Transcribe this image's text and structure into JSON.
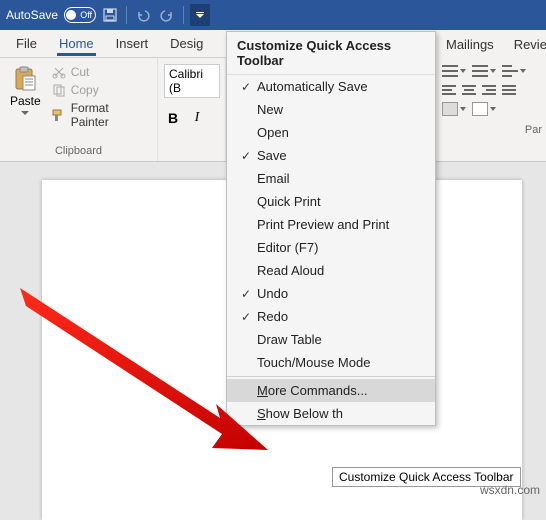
{
  "titlebar": {
    "autosave_label": "AutoSave",
    "autosave_state": "Off"
  },
  "tabs": {
    "file": "File",
    "home": "Home",
    "insert": "Insert",
    "design": "Desig",
    "mailings": "Mailings",
    "review": "Review"
  },
  "ribbon": {
    "clipboard": {
      "label": "Clipboard",
      "paste": "Paste",
      "cut": "Cut",
      "copy": "Copy",
      "format_painter": "Format Painter"
    },
    "font": {
      "name": "Calibri (B",
      "bold": "B",
      "italic": "I"
    },
    "paragraph_partial_label": "Par"
  },
  "qat_menu": {
    "title": "Customize Quick Access Toolbar",
    "items": [
      {
        "label": "Automatically Save",
        "checked": true
      },
      {
        "label": "New",
        "checked": false
      },
      {
        "label": "Open",
        "checked": false
      },
      {
        "label": "Save",
        "checked": true
      },
      {
        "label": "Email",
        "checked": false
      },
      {
        "label": "Quick Print",
        "checked": false
      },
      {
        "label": "Print Preview and Print",
        "checked": false
      },
      {
        "label": "Editor (F7)",
        "checked": false
      },
      {
        "label": "Read Aloud",
        "checked": false
      },
      {
        "label": "Undo",
        "checked": true
      },
      {
        "label": "Redo",
        "checked": true
      },
      {
        "label": "Draw Table",
        "checked": false
      },
      {
        "label": "Touch/Mouse Mode",
        "checked": false
      }
    ],
    "more_commands_prefix": "M",
    "more_commands_rest": "ore Commands...",
    "show_below_prefix": "S",
    "show_below_rest": "how Below th"
  },
  "tooltip": "Customize Quick Access Toolbar",
  "watermark": "wsxdn.com"
}
